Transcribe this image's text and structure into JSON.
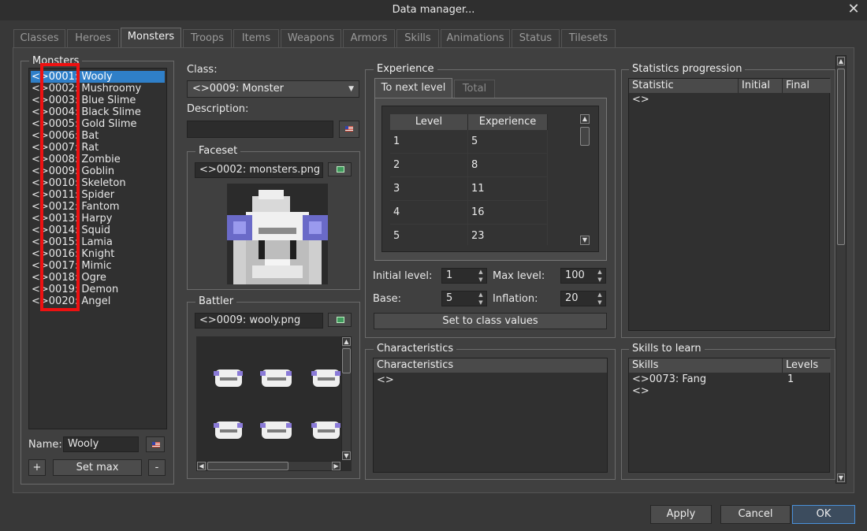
{
  "window": {
    "title": "Data manager..."
  },
  "tabs": [
    "Classes",
    "Heroes",
    "Monsters",
    "Troops",
    "Items",
    "Weapons",
    "Armors",
    "Skills",
    "Animations",
    "Status",
    "Tilesets"
  ],
  "monsters": {
    "group_title": "Monsters",
    "items": [
      "<>0001: Wooly",
      "<>0002: Mushroomy",
      "<>0003: Blue Slime",
      "<>0004: Black Slime",
      "<>0005: Gold Slime",
      "<>0006: Bat",
      "<>0007: Rat",
      "<>0008: Zombie",
      "<>0009: Goblin",
      "<>0010: Skeleton",
      "<>0011: Spider",
      "<>0012: Fantom",
      "<>0013: Harpy",
      "<>0014: Squid",
      "<>0015: Lamia",
      "<>0016: Knight",
      "<>0017: Mimic",
      "<>0018: Ogre",
      "<>0019: Demon",
      "<>0020: Angel"
    ],
    "selected_index": 0,
    "name_label": "Name:",
    "name_value": "Wooly",
    "add_label": "+",
    "set_max_label": "Set max",
    "remove_label": "-"
  },
  "klass": {
    "label": "Class:",
    "value": "<>0009: Monster",
    "description_label": "Description:",
    "description_value": ""
  },
  "faceset": {
    "title": "Faceset",
    "file": "<>0002: monsters.png"
  },
  "battler": {
    "title": "Battler",
    "file": "<>0009: wooly.png"
  },
  "experience": {
    "title": "Experience",
    "tabs": [
      "To next level",
      "Total"
    ],
    "columns": [
      "Level",
      "Experience"
    ],
    "rows": [
      [
        "1",
        "5"
      ],
      [
        "2",
        "8"
      ],
      [
        "3",
        "11"
      ],
      [
        "4",
        "16"
      ],
      [
        "5",
        "23"
      ]
    ],
    "initial_level_label": "Initial level:",
    "initial_level": "1",
    "max_level_label": "Max level:",
    "max_level": "100",
    "base_label": "Base:",
    "base": "5",
    "inflation_label": "Inflation:",
    "inflation": "20",
    "set_class_values_label": "Set to class values"
  },
  "stats": {
    "title": "Statistics progression",
    "columns": [
      "Statistic",
      "Initial",
      "Final"
    ],
    "rows": [
      "<>"
    ]
  },
  "characteristics": {
    "title": "Characteristics",
    "column": "Characteristics",
    "rows": [
      "<>"
    ]
  },
  "skills": {
    "title": "Skills to learn",
    "columns": [
      "Skills",
      "Levels"
    ],
    "rows": [
      [
        "<>0073: Fang",
        "1"
      ],
      [
        "<>",
        ""
      ]
    ]
  },
  "footer": {
    "apply": "Apply",
    "cancel": "Cancel",
    "ok": "OK"
  },
  "colors": {
    "selection": "#2f7fc8",
    "highlight_box": "#ee1111",
    "background": "#404040"
  }
}
